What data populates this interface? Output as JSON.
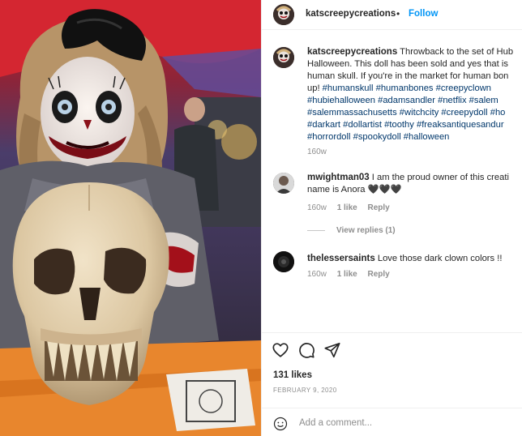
{
  "post": {
    "username": "katscreepycreations",
    "dot": "•",
    "follow_label": "Follow"
  },
  "caption": {
    "username": "katscreepycreations",
    "lines": [
      " Throwback to the set of Hub",
      "Halloween. This doll has been sold and yes that is",
      "human skull. If you're in the market for human bon",
      "up! "
    ],
    "hashtag_lines": [
      [
        "#humanskull",
        "#humanbones",
        "#creepyclown"
      ],
      [
        "#hubiehalloween",
        "#adamsandler",
        "#netflix",
        "#salem"
      ],
      [
        "#salemmassachusetts",
        "#witchcity",
        "#creepydoll",
        "#ho"
      ],
      [
        "#darkart",
        "#dollartist",
        "#toothy",
        "#freaksantiquesandur"
      ],
      [
        "#horrordoll",
        "#spookydoll",
        "#halloween"
      ]
    ],
    "age": "160w"
  },
  "comments": [
    {
      "username": "mwightman03",
      "line1": " I am the proud owner of this creati",
      "line2": "name is Anora 🖤🖤🖤",
      "age": "160w",
      "likes": "1 like",
      "reply": "Reply",
      "view_replies": "View replies (1)"
    },
    {
      "username": "thelessersaints",
      "line1": " Love those dark clown colors !!",
      "age": "160w",
      "likes": "1 like",
      "reply": "Reply"
    }
  ],
  "actions": {
    "icons": [
      "heart-icon",
      "comment-icon",
      "share-icon"
    ],
    "likes": "131 likes",
    "date": "FEBRUARY 9, 2020",
    "add_comment_placeholder": "Add a comment..."
  },
  "colors": {
    "link": "#00376b",
    "follow": "#0095f6",
    "muted": "#8e8e8e"
  }
}
